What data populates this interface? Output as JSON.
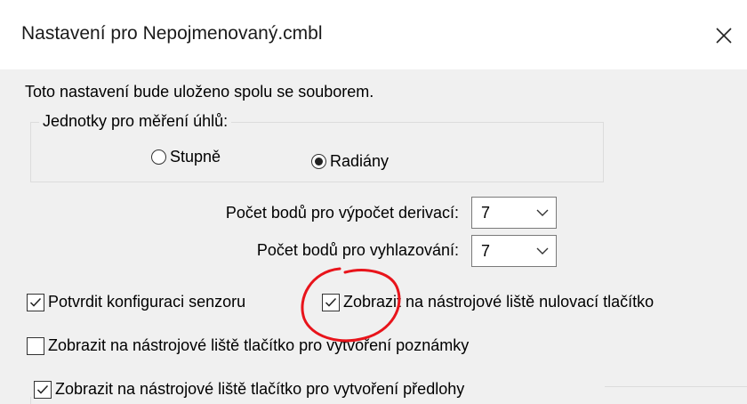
{
  "window": {
    "title": "Nastavení pro Nepojmenovaný.cmbl",
    "close_glyph": "✕"
  },
  "intro_text": "Toto nastavení bude uloženo spolu se souborem.",
  "angle_units": {
    "legend": "Jednotky pro měření úhlů:",
    "options": [
      {
        "label": "Stupně",
        "selected": false
      },
      {
        "label": "Radiány",
        "selected": true
      }
    ]
  },
  "derivative_points": {
    "label": "Počet bodů pro výpočet derivací:",
    "value": "7"
  },
  "smoothing_points": {
    "label": "Počet bodů pro vyhlazování:",
    "value": "7"
  },
  "checkboxes": [
    {
      "label": "Potvrdit konfiguraci senzoru",
      "checked": true
    },
    {
      "label": "Zobrazit na nástrojové liště nulovací tlačítko",
      "checked": true
    },
    {
      "label": "Zobrazit na nástrojové liště tlačítko pro vytvoření poznámky",
      "checked": false
    },
    {
      "label": "Zobrazit na nástrojové liště tlačítko pro vytvoření předlohy",
      "checked": true
    }
  ],
  "colors": {
    "panel_bg": "#f0f0f0",
    "annotation_red": "#e8141b"
  },
  "icons": {
    "close": "close-icon",
    "chevron": "chevron-down-icon",
    "check": "checkmark-icon"
  }
}
